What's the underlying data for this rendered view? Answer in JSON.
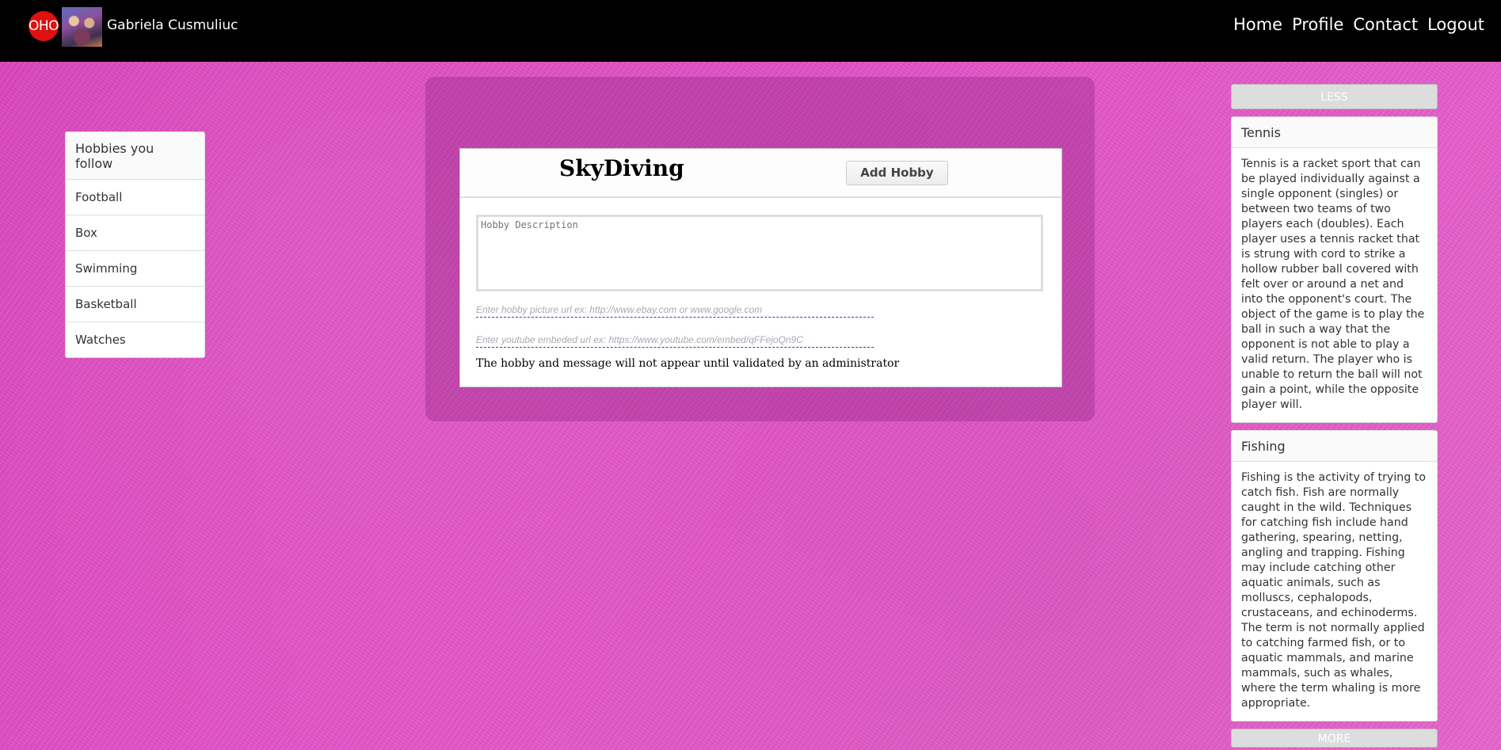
{
  "header": {
    "logo_text": "OHO",
    "user_name": "Gabriela Cusmuliuc",
    "nav": [
      "Home",
      "Profile",
      "Contact",
      "Logout"
    ]
  },
  "sidebar": {
    "title": "Hobbies you follow",
    "items": [
      "Football",
      "Box",
      "Swimming",
      "Basketball",
      "Watches"
    ]
  },
  "hobby_form": {
    "title": "SkyDiving",
    "add_button": "Add Hobby",
    "description_placeholder": "Hobby Description",
    "picture_placeholder": "Enter hobby picture url ex: http://www.ebay.com or www.google.com",
    "youtube_placeholder": "Enter youtube embeded url ex: https://www.youtube.com/embed/qFFejoQn9C",
    "notice": "The hobby and message will not appear until validated by an administrator"
  },
  "right_panel": {
    "less_button": "LESS",
    "more_button": "MORE",
    "cards": [
      {
        "title": "Tennis",
        "body": "Tennis is a racket sport that can be played individually against a single opponent (singles) or between two teams of two players each (doubles). Each player uses a tennis racket that is strung with cord to strike a hollow rubber ball covered with felt over or around a net and into the opponent's court. The object of the game is to play the ball in such a way that the opponent is not able to play a valid return. The player who is unable to return the ball will not gain a point, while the opposite player will."
      },
      {
        "title": "Fishing",
        "body": "Fishing is the activity of trying to catch fish. Fish are normally caught in the wild. Techniques for catching fish include hand gathering, spearing, netting, angling and trapping. Fishing may include catching other aquatic animals, such as molluscs, cephalopods, crustaceans, and echinoderms. The term is not normally applied to catching farmed fish, or to aquatic mammals, and marine mammals, such as whales, where the term whaling is more appropriate."
      }
    ]
  },
  "colors": {
    "background": "#e24fc4",
    "topbar": "#000000",
    "logo_badge": "#e01010"
  }
}
